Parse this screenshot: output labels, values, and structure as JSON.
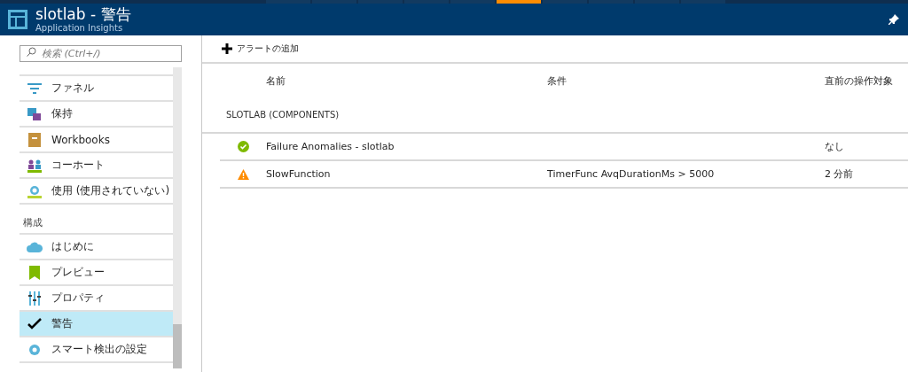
{
  "top_tabs": [
    {
      "selected": false
    },
    {
      "selected": false
    },
    {
      "selected": false
    },
    {
      "selected": false
    },
    {
      "selected": false
    },
    {
      "selected": true
    },
    {
      "selected": false
    },
    {
      "selected": false
    },
    {
      "selected": false
    },
    {
      "selected": false
    }
  ],
  "header": {
    "title": "slotlab - 警告",
    "subtitle": "Application Insights"
  },
  "search": {
    "placeholder": "検索 (Ctrl+/)"
  },
  "sidebar": {
    "items": [
      {
        "kind": "item",
        "label": "ファネル",
        "selected": false
      },
      {
        "kind": "item",
        "label": "保持",
        "selected": false
      },
      {
        "kind": "item",
        "label": "Workbooks",
        "selected": false
      },
      {
        "kind": "item",
        "label": "コーホート",
        "selected": false
      },
      {
        "kind": "item",
        "label": "使用 (使用されていない)",
        "selected": false
      },
      {
        "kind": "section",
        "label": "構成"
      },
      {
        "kind": "item",
        "label": "はじめに",
        "selected": false
      },
      {
        "kind": "item",
        "label": "プレビュー",
        "selected": false
      },
      {
        "kind": "item",
        "label": "プロパティ",
        "selected": false
      },
      {
        "kind": "item",
        "label": "警告",
        "selected": true
      },
      {
        "kind": "item",
        "label": "スマート検出の設定",
        "selected": false
      }
    ]
  },
  "toolbar": {
    "add_button": "アラートの追加"
  },
  "table": {
    "columns": [
      "名前",
      "条件",
      "直前の操作対象"
    ],
    "group": "SLOTLAB (COMPONENTS)",
    "rows": [
      {
        "kind": "ok",
        "name": "Failure Anomalies - slotlab",
        "condition": "",
        "last": "なし"
      },
      {
        "kind": "warning",
        "name": "SlowFunction",
        "condition": "TimerFunc AvqDurationMs > 5000",
        "last": "2 分前"
      }
    ]
  }
}
